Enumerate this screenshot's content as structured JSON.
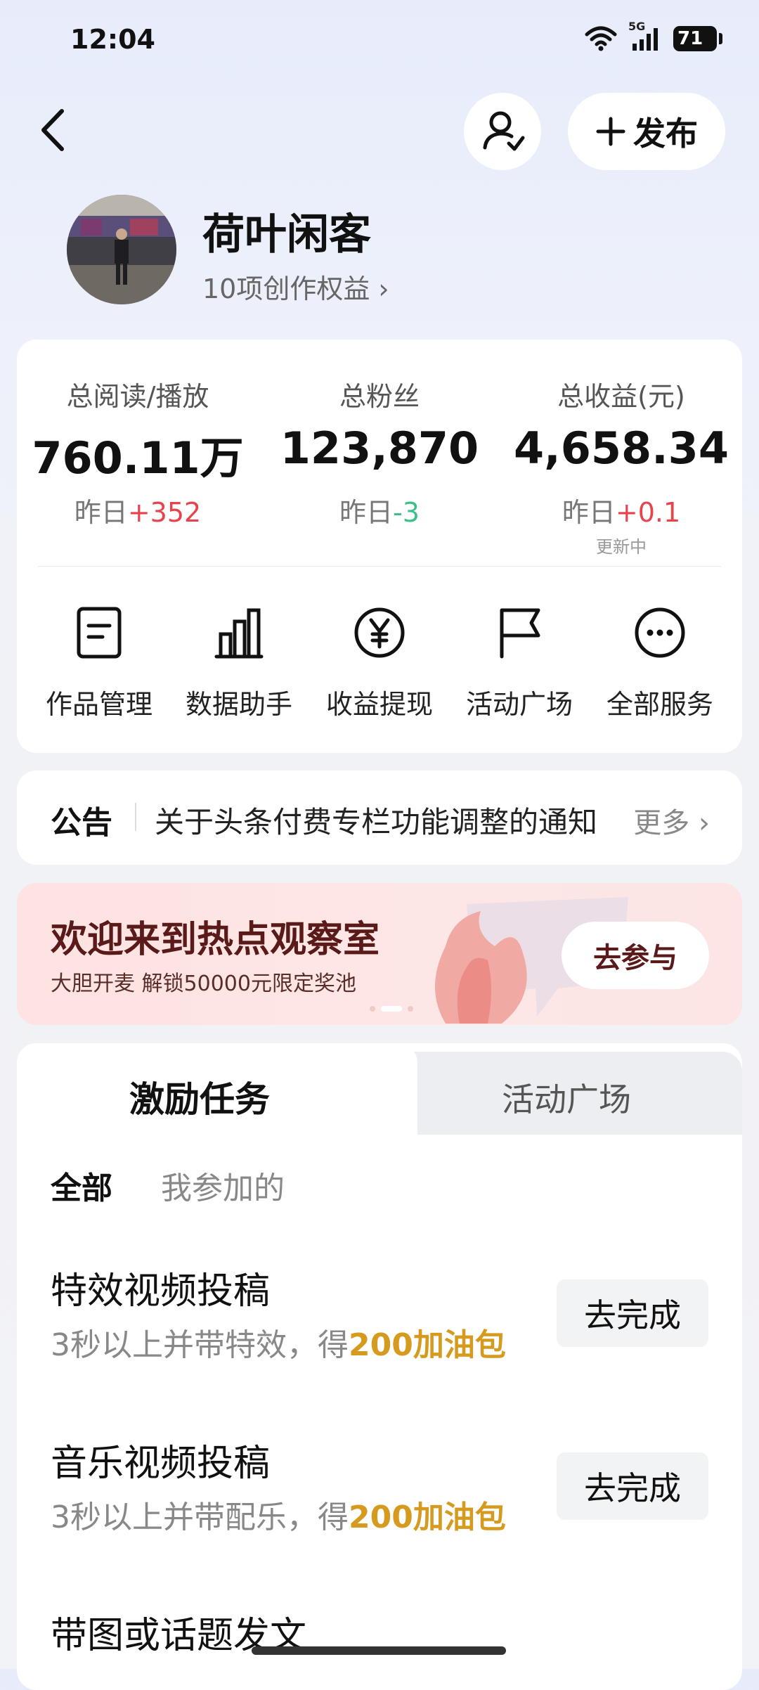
{
  "status_bar": {
    "time": "12:04",
    "network": "5G",
    "battery": "71"
  },
  "header": {
    "publish_label": "发布"
  },
  "profile": {
    "name": "荷叶闲客",
    "benefits": "10项创作权益 ›"
  },
  "stats": [
    {
      "label": "总阅读/播放",
      "value": "760.11万",
      "delta_prefix": "昨日",
      "delta": "+352",
      "trend": "up"
    },
    {
      "label": "总粉丝",
      "value": "123,870",
      "delta_prefix": "昨日",
      "delta": "-3",
      "trend": "down"
    },
    {
      "label": "总收益(元)",
      "value": "4,658.34",
      "delta_prefix": "昨日",
      "delta": "+0.1",
      "trend": "up",
      "note": "更新中"
    }
  ],
  "shortcuts": [
    {
      "label": "作品管理",
      "icon": "document-icon"
    },
    {
      "label": "数据助手",
      "icon": "bar-chart-icon"
    },
    {
      "label": "收益提现",
      "icon": "yen-circle-icon"
    },
    {
      "label": "活动广场",
      "icon": "flag-icon"
    },
    {
      "label": "全部服务",
      "icon": "more-icon"
    }
  ],
  "notice": {
    "title": "公告",
    "text": "关于头条付费专栏功能调整的通知",
    "more": "更多 ›"
  },
  "banner": {
    "title": "欢迎来到热点观察室",
    "subtitle": "大胆开麦 解锁50000元限定奖池",
    "button": "去参与"
  },
  "tasks": {
    "tabs": [
      "激励任务",
      "活动广场"
    ],
    "filters": [
      "全部",
      "我参加的"
    ],
    "items": [
      {
        "title": "特效视频投稿",
        "desc": "3秒以上并带特效，得",
        "reward": "200加油包",
        "button": "去完成"
      },
      {
        "title": "音乐视频投稿",
        "desc": "3秒以上并带配乐，得",
        "reward": "200加油包",
        "button": "去完成"
      },
      {
        "title": "带图或话题发文"
      }
    ]
  },
  "colors": {
    "up": "#e8424b",
    "down": "#3cc08a",
    "reward": "#d69b1e",
    "banner_text": "#5a1a1a"
  }
}
